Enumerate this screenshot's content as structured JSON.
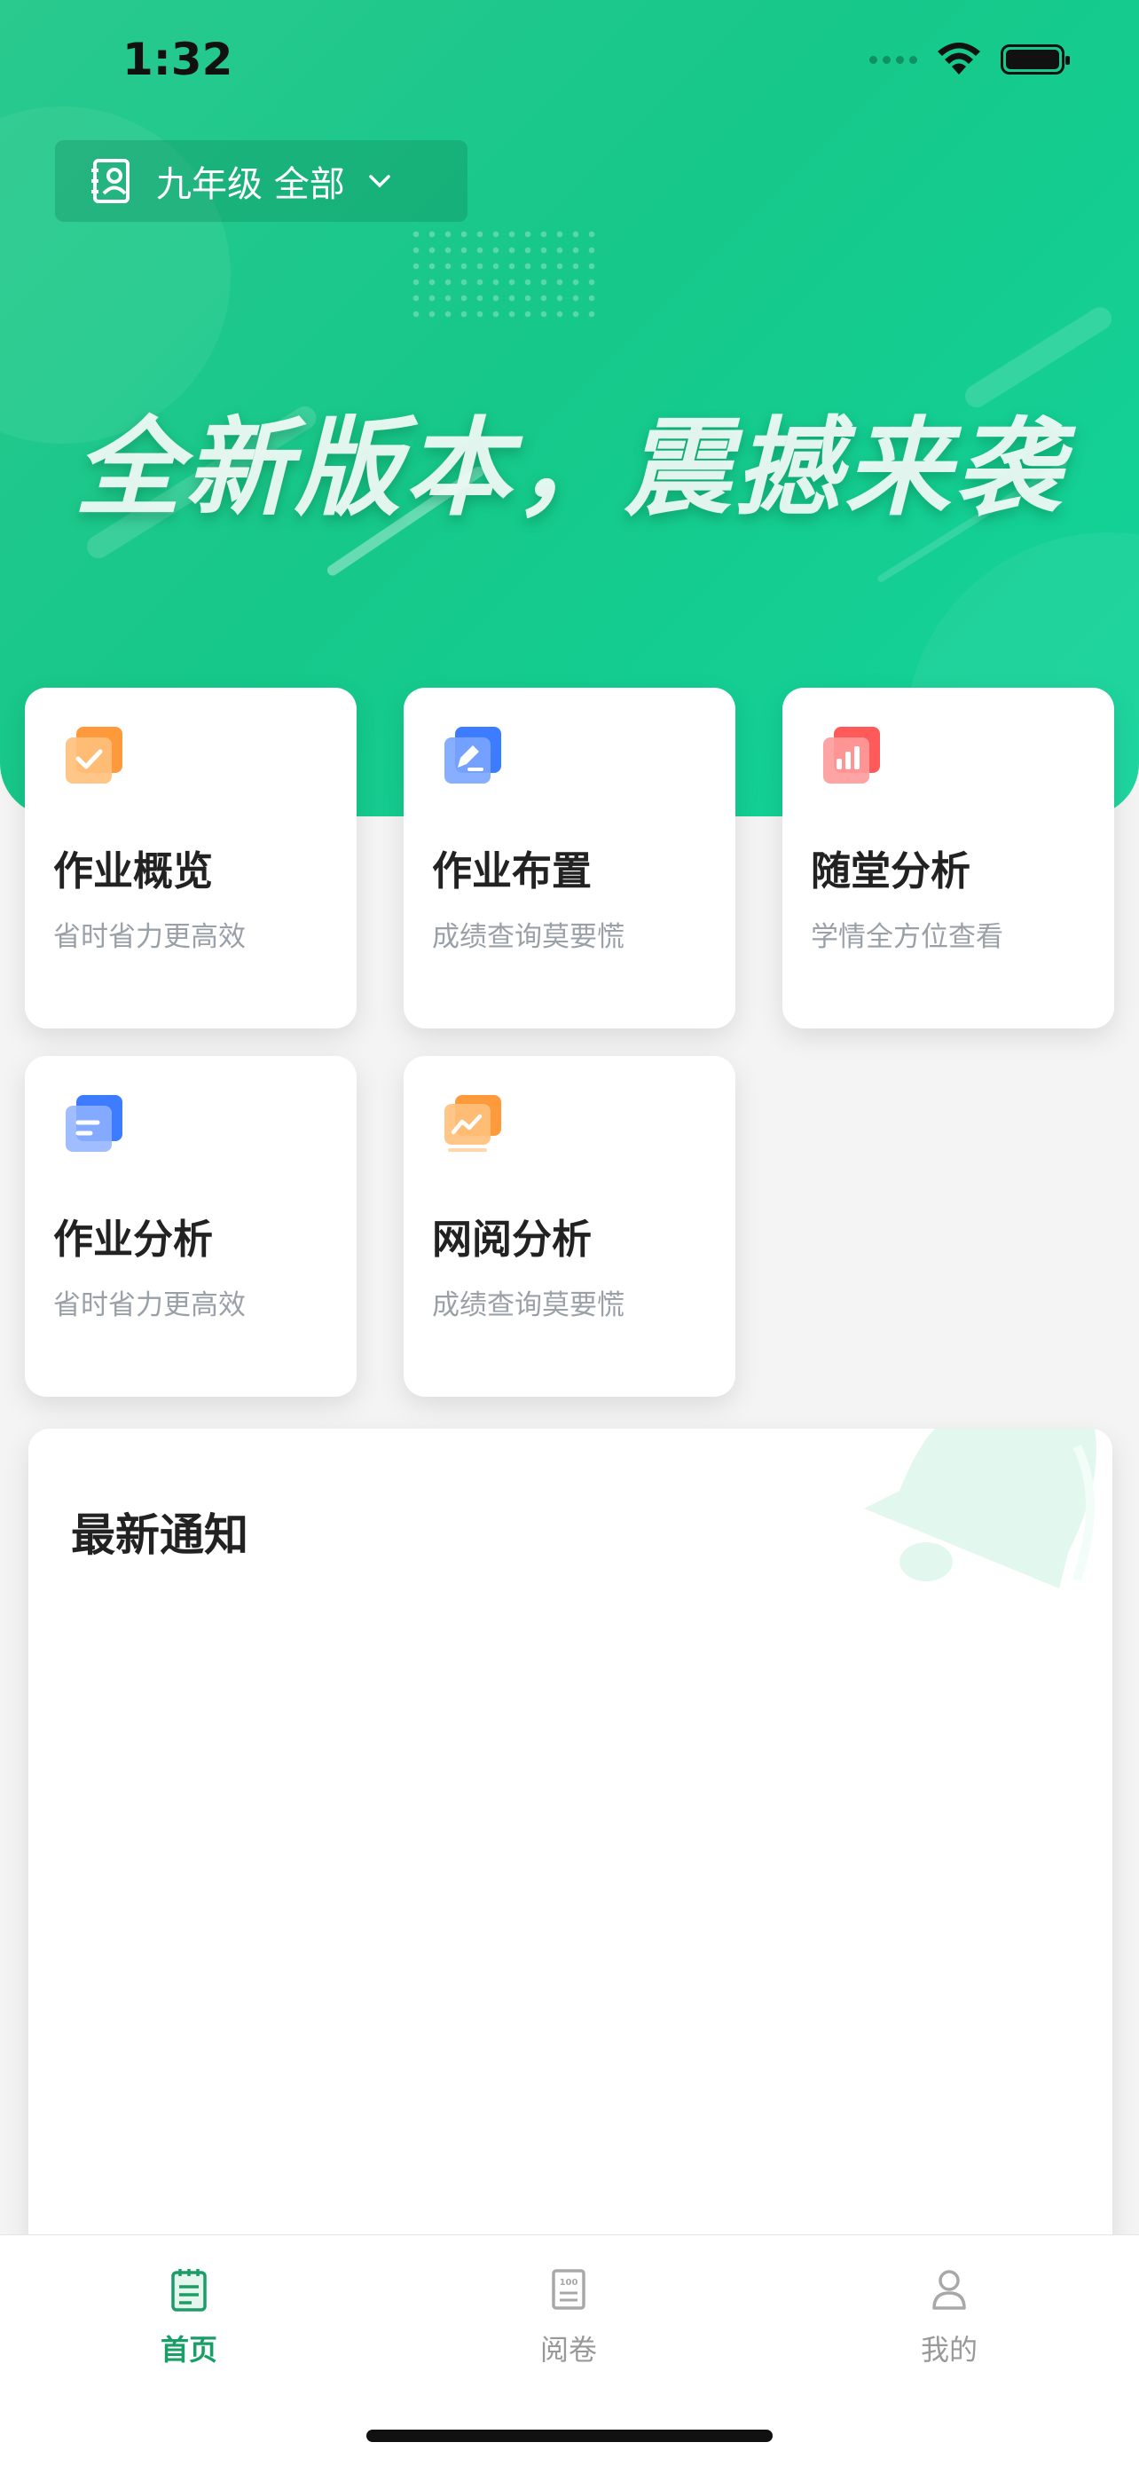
{
  "status_bar": {
    "time": "1:32"
  },
  "header": {
    "grade_selector": "九年级 全部",
    "banner_text": "全新版本，震撼来袭"
  },
  "cards": [
    {
      "title": "作业概览",
      "subtitle": "省时省力更高效",
      "icon": "homework-overview-icon",
      "color": "#ff9a3c"
    },
    {
      "title": "作业布置",
      "subtitle": "成绩查询莫要慌",
      "icon": "homework-assign-icon",
      "color": "#3d7bff"
    },
    {
      "title": "随堂分析",
      "subtitle": "学情全方位查看",
      "icon": "class-analysis-icon",
      "color": "#ff5a5a"
    },
    {
      "title": "作业分析",
      "subtitle": "省时省力更高效",
      "icon": "homework-analysis-icon",
      "color": "#3d7bff"
    },
    {
      "title": "网阅分析",
      "subtitle": "成绩查询莫要慌",
      "icon": "online-marking-analysis-icon",
      "color": "#ff9a3c"
    }
  ],
  "notice": {
    "title": "最新通知"
  },
  "tabbar": {
    "items": [
      {
        "label": "首页",
        "icon": "home-icon",
        "active": true
      },
      {
        "label": "阅卷",
        "icon": "marking-icon",
        "active": false
      },
      {
        "label": "我的",
        "icon": "profile-icon",
        "active": false
      }
    ]
  }
}
